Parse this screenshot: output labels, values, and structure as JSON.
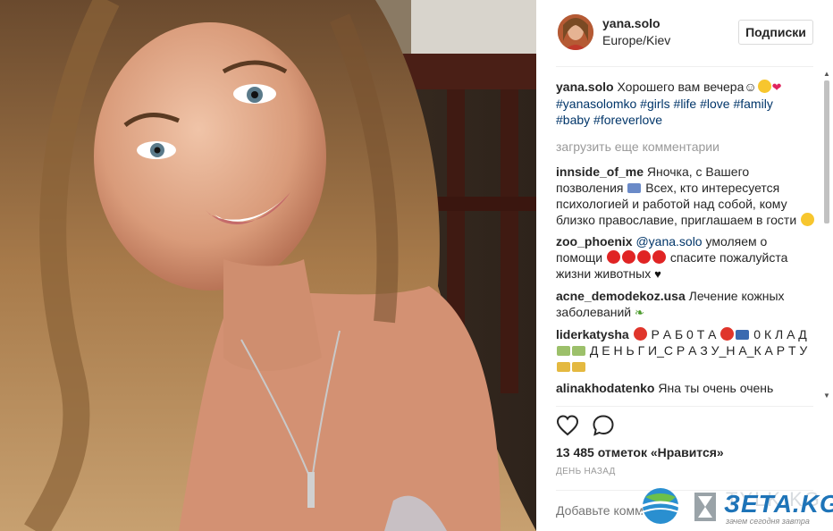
{
  "post": {
    "username": "yana.solo",
    "location": "Europe/Kiev",
    "follow_label": "Подписки",
    "caption": {
      "user": "yana.solo",
      "text": "Хорошего вам вечера☺",
      "hashtags": [
        "#yanasolomko",
        "#girls",
        "#life",
        "#love",
        "#family",
        "#baby",
        "#foreverlove"
      ]
    },
    "load_more_label": "загрузить еще комментарии",
    "comments": [
      {
        "user": "innside_of_me",
        "text1": "Яночка, с Вашего позволения",
        "text2": "Всех, кто интересуется психологией и работой над собой, кому близко православие, приглашаем в гости"
      },
      {
        "user": "zoo_phoenix",
        "mention": "@yana.solo",
        "text1": "умоляем о помощи",
        "text2": "спасите пожалуйста жизни животных"
      },
      {
        "user": "acne_demodekoz.usa",
        "text1": "Лечение кожных заболеваний"
      },
      {
        "user": "liderkatysha",
        "text1": "Р А Б 0 Т А",
        "text2": "0 К Л А Д",
        "text3": "Д Е Н Ь Г И_С Р А З У_Н А_К А Р Т У"
      },
      {
        "user": "alinakhodatenko",
        "text1": "Яна ты очень очень"
      }
    ],
    "likes_text": "13 485 отметок «Нравится»",
    "time_ago": "день назад",
    "add_comment_placeholder": "Добавьте комм"
  },
  "icons": {
    "like": "heart-outline-icon",
    "comment": "speech-bubble-icon"
  },
  "watermark": {
    "brand": "ЗЕТА.KG",
    "ghost": "TYLK.KG",
    "tagline": "зачем сегодня завтра"
  },
  "colors": {
    "hashtag": "#003569",
    "brand_blue": "#1e74b8",
    "muted": "#999999"
  }
}
